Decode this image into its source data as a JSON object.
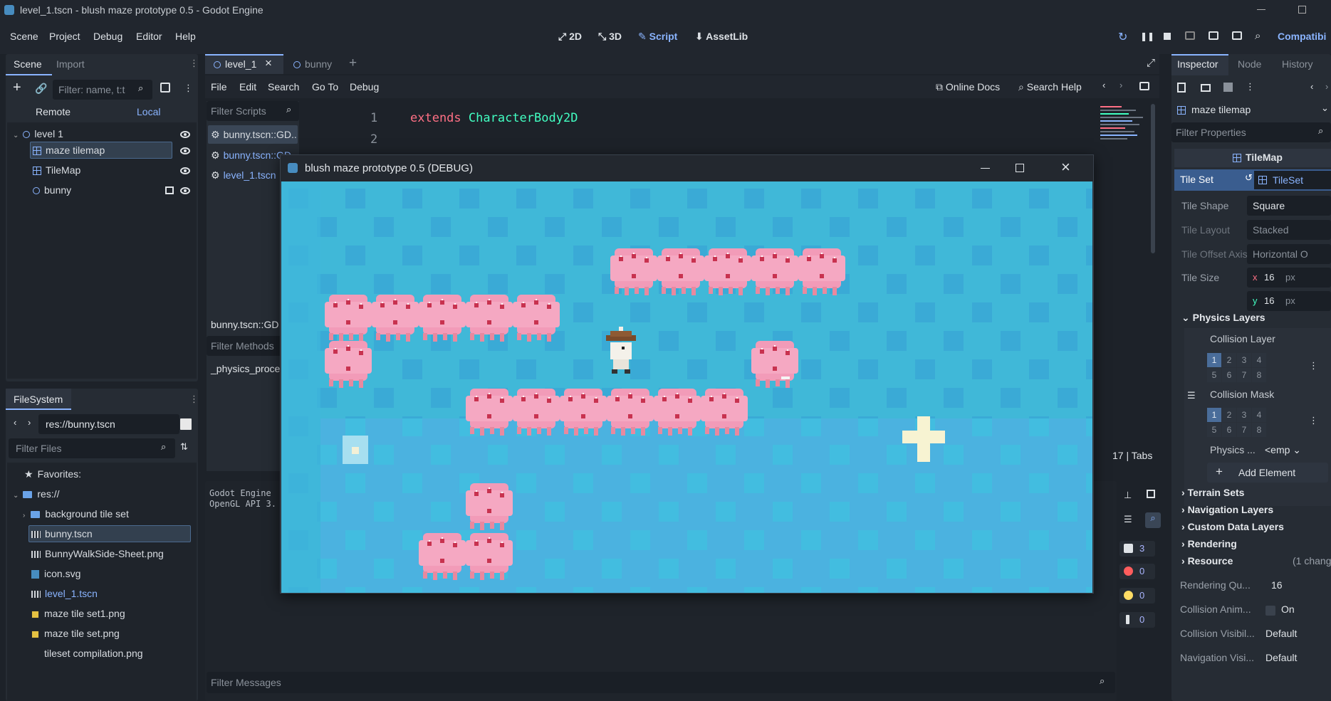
{
  "window_title": "level_1.tscn - blush maze prototype 0.5 - Godot Engine",
  "menu": [
    "Scene",
    "Project",
    "Debug",
    "Editor",
    "Help"
  ],
  "workspaces": [
    "2D",
    "3D",
    "Script",
    "AssetLib"
  ],
  "renderer": "Compatibi",
  "colors": {
    "accent": "#8ab4ff",
    "keyword": "#ff7085",
    "type": "#42ffc2",
    "game_bg": "#40b8d8",
    "jelly": "#f4a3bd"
  },
  "scene_dock": {
    "tabs": [
      "Scene",
      "Import"
    ],
    "filter_placeholder": "Filter: name, t:t",
    "remote": "Remote",
    "local": "Local",
    "tree": [
      {
        "label": "level 1",
        "icon": "node-icon"
      },
      {
        "label": "maze tilemap",
        "icon": "tilemap-icon"
      },
      {
        "label": "TileMap",
        "icon": "tilemap-icon"
      },
      {
        "label": "bunny",
        "icon": "node-icon"
      }
    ]
  },
  "filesystem": {
    "tab": "FileSystem",
    "path": "res://bunny.tscn",
    "filter_placeholder": "Filter Files",
    "favorites": "Favorites:",
    "root": "res://",
    "items": [
      "background tile set",
      "bunny.tscn",
      "BunnyWalkSide-Sheet.png",
      "icon.svg",
      "level_1.tscn",
      "maze tile set1.png",
      "maze tile set.png",
      "tileset compilation.png"
    ]
  },
  "editor_tabs": [
    "level_1",
    "bunny"
  ],
  "script_menu": [
    "File",
    "Edit",
    "Search",
    "Go To",
    "Debug"
  ],
  "online_docs": "Online Docs",
  "search_help": "Search Help",
  "filter_scripts": "Filter Scripts",
  "scripts": [
    "bunny.tscn::GD...",
    "bunny.tscn::GD...",
    "level_1.tscn"
  ],
  "script_label": "bunny.tscn::GD",
  "filter_methods": "Filter Methods",
  "method": "_physics_proce",
  "code": {
    "line1_num": "1",
    "line2_num": "2",
    "extends_kw": "extends",
    "extends_type": "CharacterBody2D"
  },
  "status": {
    "line": "17",
    "sep": "|",
    "indent": "Tabs"
  },
  "output": {
    "line1": "Godot Engine",
    "line2": "OpenGL API 3."
  },
  "filter_messages": "Filter Messages",
  "counters": {
    "messages": "3",
    "errors": "0",
    "warnings": "0",
    "editor": "0"
  },
  "game_window": {
    "title": "blush maze prototype 0.5 (DEBUG)"
  },
  "inspector": {
    "tabs": [
      "Inspector",
      "Node",
      "History"
    ],
    "node": "maze tilemap",
    "filter_placeholder": "Filter Properties",
    "class": "TileMap",
    "tile_set_label": "Tile Set",
    "tile_set_value": "TileSet",
    "props": [
      {
        "label": "Tile Shape",
        "value": "Square"
      },
      {
        "label": "Tile Layout",
        "value": "Stacked"
      },
      {
        "label": "Tile Offset Axis",
        "value": "Horizontal O"
      },
      {
        "label": "Tile Size",
        "value": ""
      }
    ],
    "tile_size_x_label": "x",
    "tile_size_x": "16",
    "tile_size_y_label": "y",
    "tile_size_y": "16",
    "px": "px",
    "physics_layers": "Physics Layers",
    "collision_layer": "Collision Layer",
    "collision_mask": "Collision Mask",
    "bits": [
      "1",
      "2",
      "3",
      "4",
      "5",
      "6",
      "7",
      "8"
    ],
    "physics_material_label": "Physics ...",
    "physics_material_value": "<emp",
    "add_element": "Add Element",
    "sections": [
      "Terrain Sets",
      "Navigation Layers",
      "Custom Data Layers",
      "Rendering",
      "Resource"
    ],
    "resource_note": "(1 chang",
    "rendering_q_label": "Rendering Qu...",
    "rendering_q_value": "16",
    "collision_anim_label": "Collision Anim...",
    "collision_anim_value": "On",
    "collision_vis_label": "Collision Visibil...",
    "collision_vis_value": "Default",
    "nav_vis_label": "Navigation Visi...",
    "nav_vis_value": "Default"
  }
}
